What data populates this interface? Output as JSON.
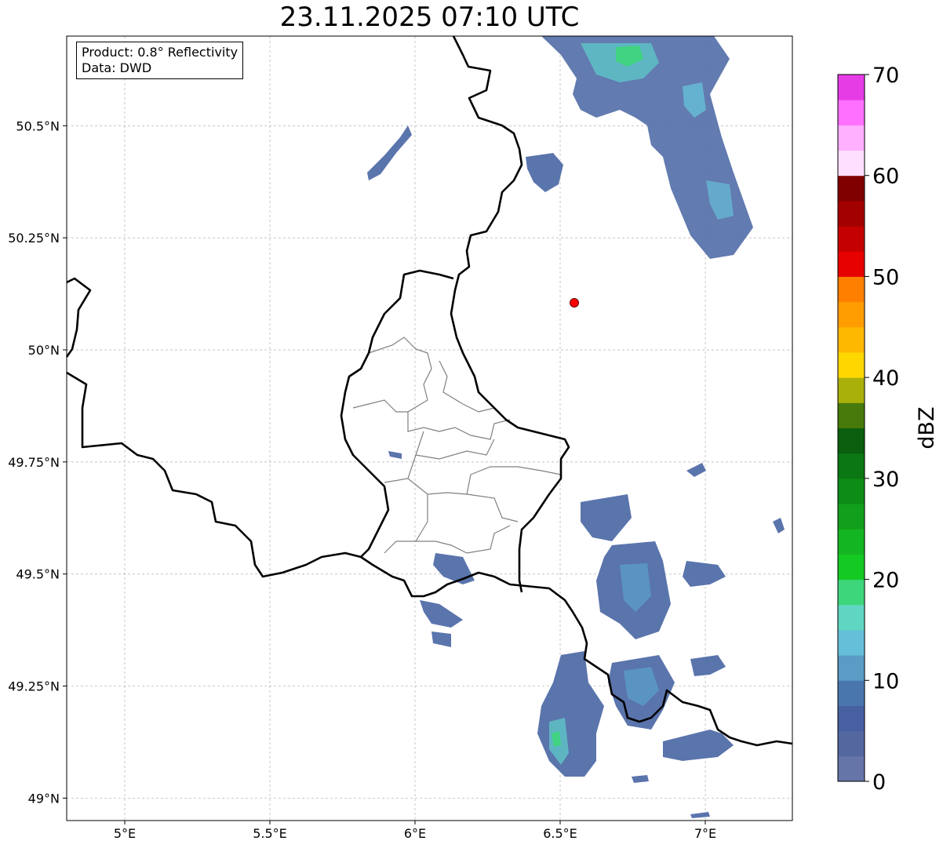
{
  "title": "23.11.2025 07:10 UTC",
  "info": {
    "product": "Product: 0.8° Reflectivity",
    "data": "Data: DWD"
  },
  "axes": {
    "x_ticks": [
      {
        "value": 5.0,
        "label": "5°E"
      },
      {
        "value": 5.5,
        "label": "5.5°E"
      },
      {
        "value": 6.0,
        "label": "6°E"
      },
      {
        "value": 6.5,
        "label": "6.5°E"
      },
      {
        "value": 7.0,
        "label": "7°E"
      }
    ],
    "y_ticks": [
      {
        "value": 50.5,
        "label": "50.5°N"
      },
      {
        "value": 50.25,
        "label": "50.25°N"
      },
      {
        "value": 50.0,
        "label": "50°N"
      },
      {
        "value": 49.75,
        "label": "49.75°N"
      },
      {
        "value": 49.5,
        "label": "49.5°N"
      },
      {
        "value": 49.25,
        "label": "49.25°N"
      },
      {
        "value": 49.0,
        "label": "49°N"
      }
    ],
    "lon_range": [
      4.8,
      7.3
    ],
    "lat_range": [
      48.95,
      50.7
    ],
    "grid": true
  },
  "colorbar": {
    "label": "dBZ",
    "range": [
      0,
      70
    ],
    "ticks": [
      {
        "value": 0,
        "label": "0"
      },
      {
        "value": 10,
        "label": "10"
      },
      {
        "value": 20,
        "label": "20"
      },
      {
        "value": 30,
        "label": "30"
      },
      {
        "value": 40,
        "label": "40"
      },
      {
        "value": 50,
        "label": "50"
      },
      {
        "value": 60,
        "label": "60"
      },
      {
        "value": 70,
        "label": "70"
      }
    ],
    "colors": [
      "#6675a8",
      "#54689f",
      "#4660a2",
      "#4a76ae",
      "#5a9cc5",
      "#66bfd8",
      "#5fd6c2",
      "#3ed67b",
      "#14c922",
      "#14b522",
      "#129f1b",
      "#0d8c16",
      "#0b7714",
      "#0a5e0e",
      "#477a0a",
      "#aab00a",
      "#ffd700",
      "#ffb800",
      "#ff9c00",
      "#ff7f00",
      "#e60000",
      "#c40000",
      "#a30000",
      "#800000",
      "#ffdfff",
      "#ffb0ff",
      "#ff70ff",
      "#e63ce6"
    ]
  },
  "colors": {
    "border_national": "#000000",
    "border_regional": "#808080",
    "radar_site": "#ff0000",
    "gridline": "#b0b0b0"
  }
}
